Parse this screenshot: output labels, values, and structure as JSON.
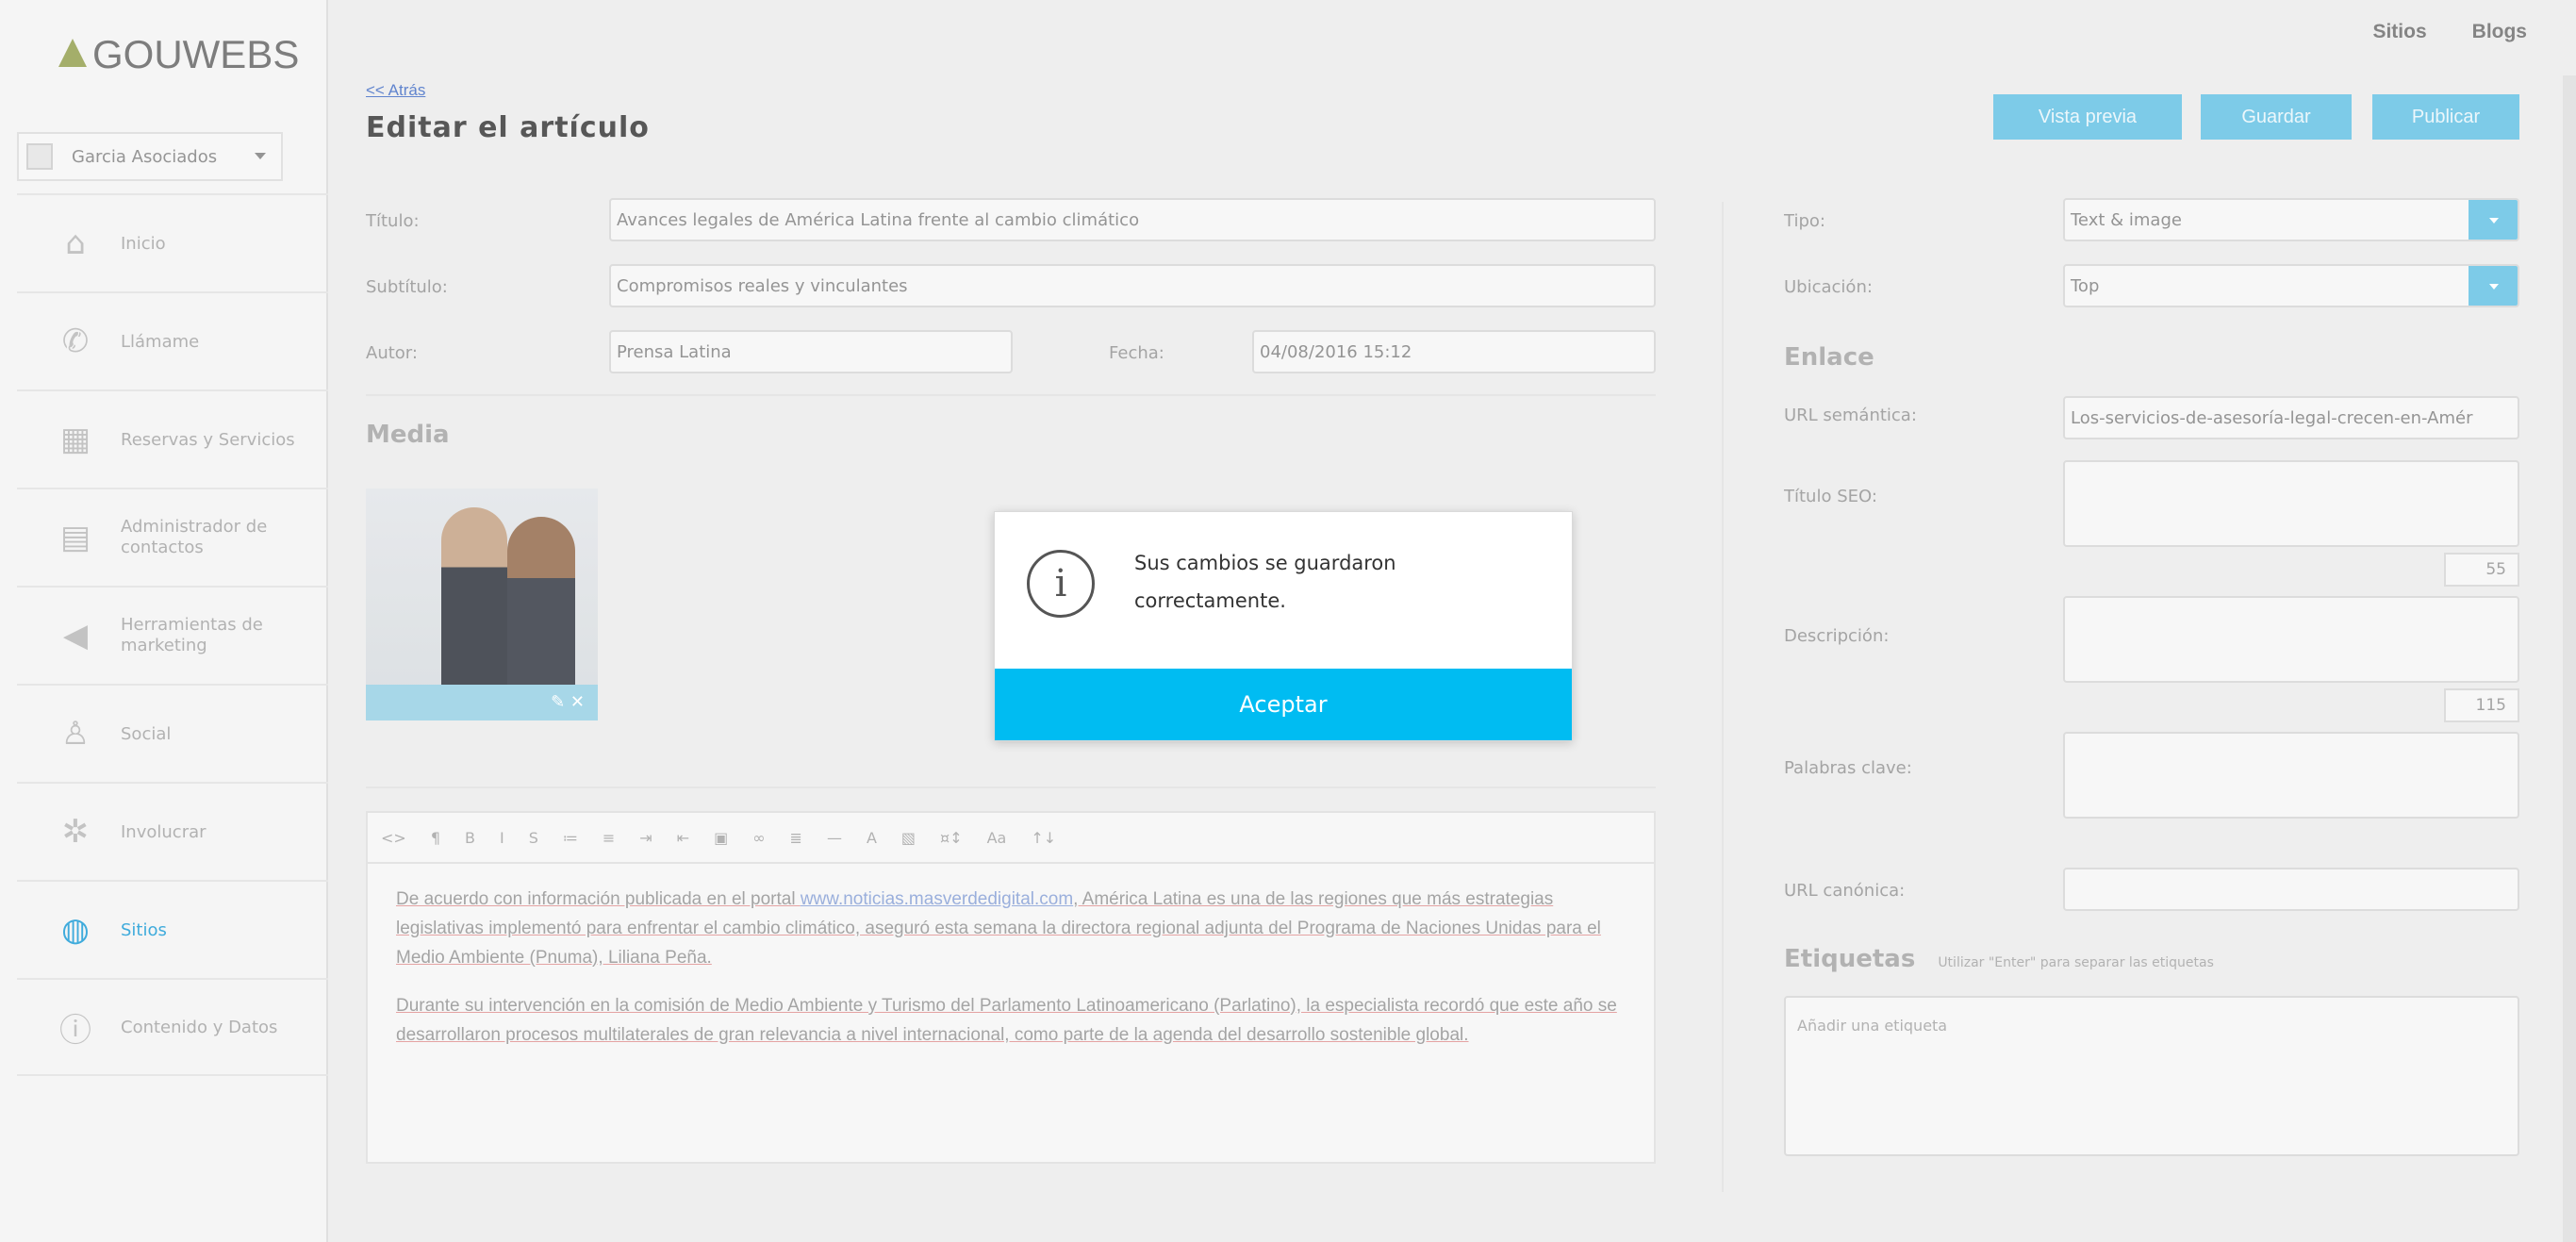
{
  "brand": {
    "logo": "GOUWEBS"
  },
  "account": {
    "name": "Garcia Asociados"
  },
  "sidebar": {
    "items": [
      {
        "label": "Inicio",
        "icon": "home-icon"
      },
      {
        "label": "Llámame",
        "icon": "phone-icon"
      },
      {
        "label": "Reservas y Servicios",
        "icon": "calendar-icon"
      },
      {
        "label": "Administrador de contactos",
        "icon": "contacts-icon"
      },
      {
        "label": "Herramientas de marketing",
        "icon": "megaphone-icon"
      },
      {
        "label": "Social",
        "icon": "people-icon"
      },
      {
        "label": "Involucrar",
        "icon": "network-icon"
      },
      {
        "label": "Sitios",
        "icon": "globe-icon"
      },
      {
        "label": "Contenido y Datos",
        "icon": "info-icon"
      }
    ]
  },
  "topnav": {
    "sites": "Sitios",
    "blogs": "Blogs"
  },
  "header": {
    "back": "<< Atrás",
    "title": "Editar el artículo"
  },
  "actions": {
    "preview": "Vista previa",
    "save": "Guardar",
    "publish": "Publicar"
  },
  "form": {
    "title_label": "Título:",
    "title_value": "Avances legales de América Latina frente al cambio climático",
    "subtitle_label": "Subtítulo:",
    "subtitle_value": "Compromisos reales y vinculantes",
    "author_label": "Autor:",
    "author_value": "Prensa Latina",
    "date_label": "Fecha:",
    "date_value": "04/08/2016 15:12",
    "media_heading": "Media"
  },
  "right": {
    "type_label": "Tipo:",
    "type_value": "Text & image",
    "location_label": "Ubicación:",
    "location_value": "Top",
    "link_heading": "Enlace",
    "semantic_label": "URL semántica:",
    "semantic_value": "Los-servicios-de-asesoría-legal-crecen-en-Amér",
    "seo_label": "Título SEO:",
    "seo_count": "55",
    "desc_label": "Descripción:",
    "desc_count": "115",
    "keywords_label": "Palabras clave:",
    "canonical_label": "URL canónica:",
    "tags_heading": "Etiquetas",
    "tags_hint": "Utilizar \"Enter\" para separar las etiquetas",
    "tag_placeholder": "Añadir una etiqueta"
  },
  "editor": {
    "toolbar": [
      "<>",
      "¶",
      "B",
      "I",
      "S",
      "≔",
      "≡",
      "⇥",
      "⇤",
      "▣",
      "∞",
      "≣",
      "—",
      "A",
      "▧",
      "¤↕",
      "Aa",
      "↑↓"
    ],
    "p1": {
      "a": "De acuerdo con información publicada en el portal ",
      "link": "www.noticias.masverdedigital.com",
      "b": ", América Latina es una de las regiones que más estrategias legislativas implementó para enfrentar el cambio climático, aseguró esta semana la directora regional adjunta del Programa de Naciones Unidas para el Medio Ambiente (Pnuma), Liliana Peña."
    },
    "p2": "Durante su intervención en la comisión de Medio Ambiente y Turismo del Parlamento Latinoamericano (Parlatino), la especialista recordó que este año se desarrollaron procesos multilaterales de gran relevancia a nivel internacional, como parte de la agenda del desarrollo sostenible global."
  },
  "dialog": {
    "message": "Sus cambios se guardaron correctamente.",
    "ok": "Aceptar"
  }
}
